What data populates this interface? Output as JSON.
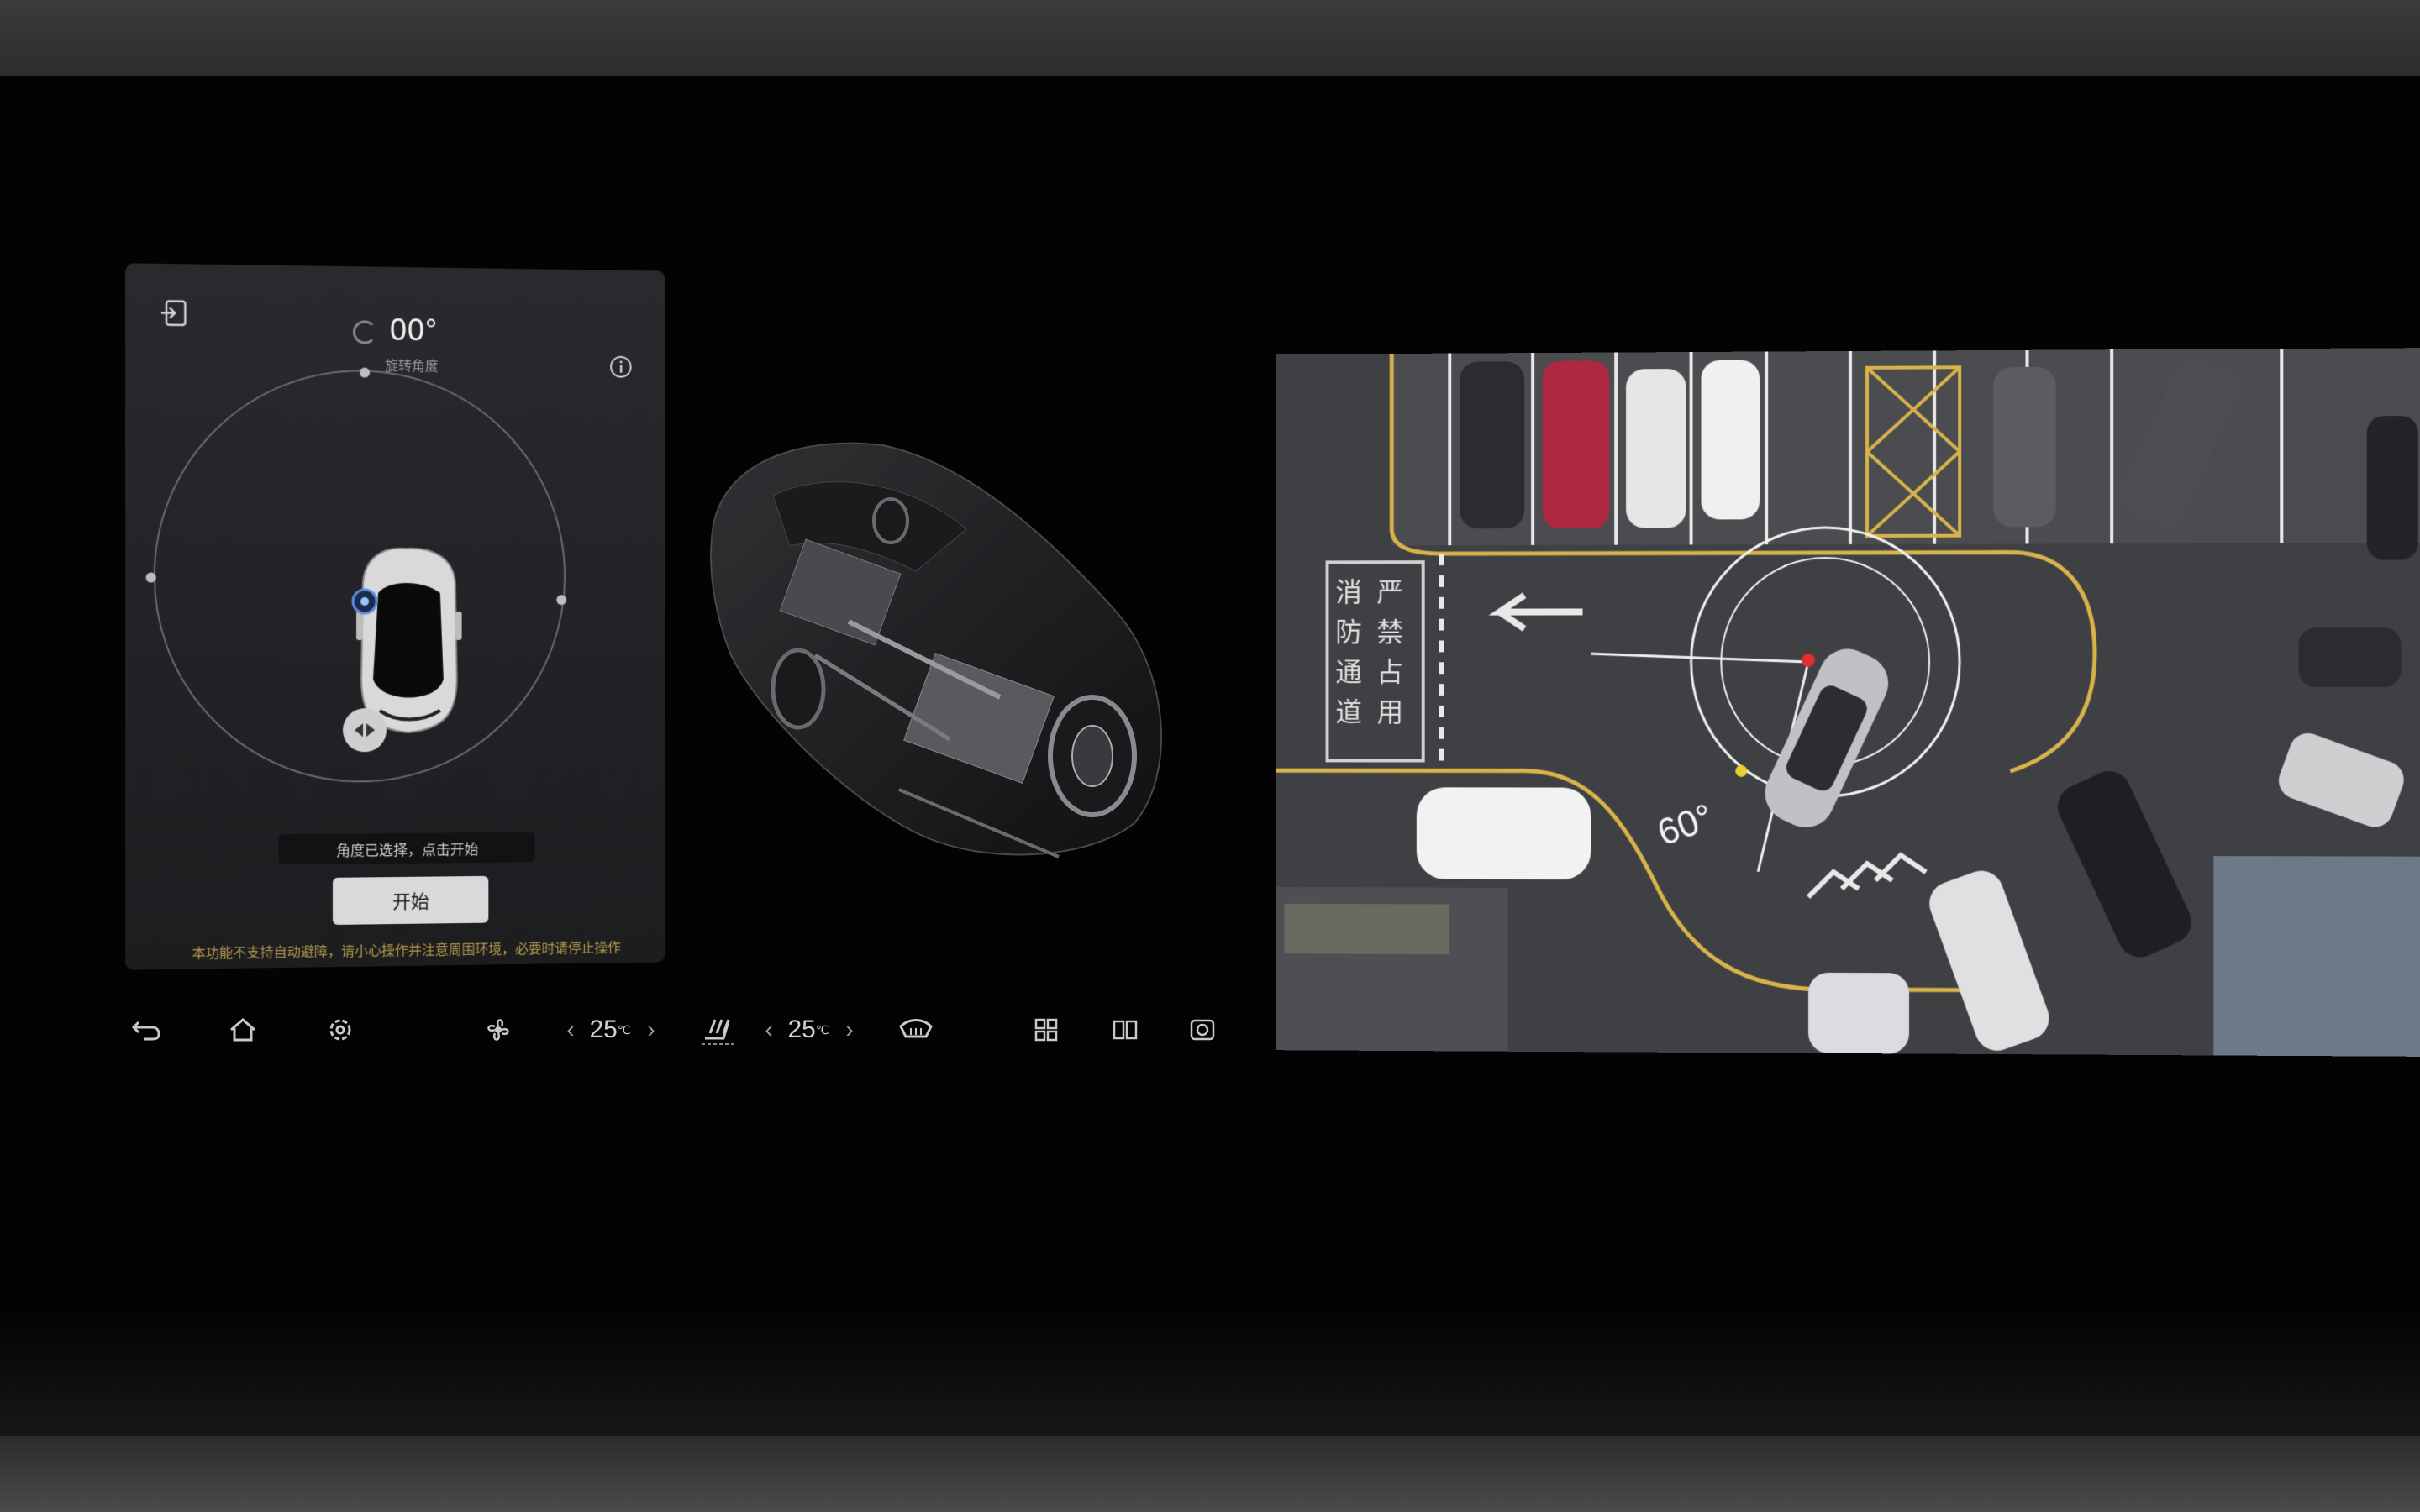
{
  "rotation_panel": {
    "angle_value": "00°",
    "angle_label": "旋转角度",
    "status_text": "角度已选择，点击开始",
    "start_label": "开始",
    "warning_text": "本功能不支持自动避障，请小心操作并注意周围环境，必要时请停止操作"
  },
  "bottom_bar": {
    "left_temp": "25",
    "right_temp": "25",
    "temp_unit": "℃"
  },
  "aerial_view": {
    "angle_text": "60°",
    "road_text_col1": "消防通道",
    "road_text_col2": "严禁占用"
  },
  "icons": [
    "exit-icon",
    "info-icon",
    "back-icon",
    "home-icon",
    "settings-icon",
    "fan-icon",
    "seat-heat-icon",
    "defrost-icon",
    "grid-icon",
    "split-view-icon",
    "camera-icon"
  ],
  "colors": {
    "panel": "#222226",
    "accent_warning": "#b49a4a",
    "button": "#d9d9db",
    "road_line": "#d8b24a"
  }
}
